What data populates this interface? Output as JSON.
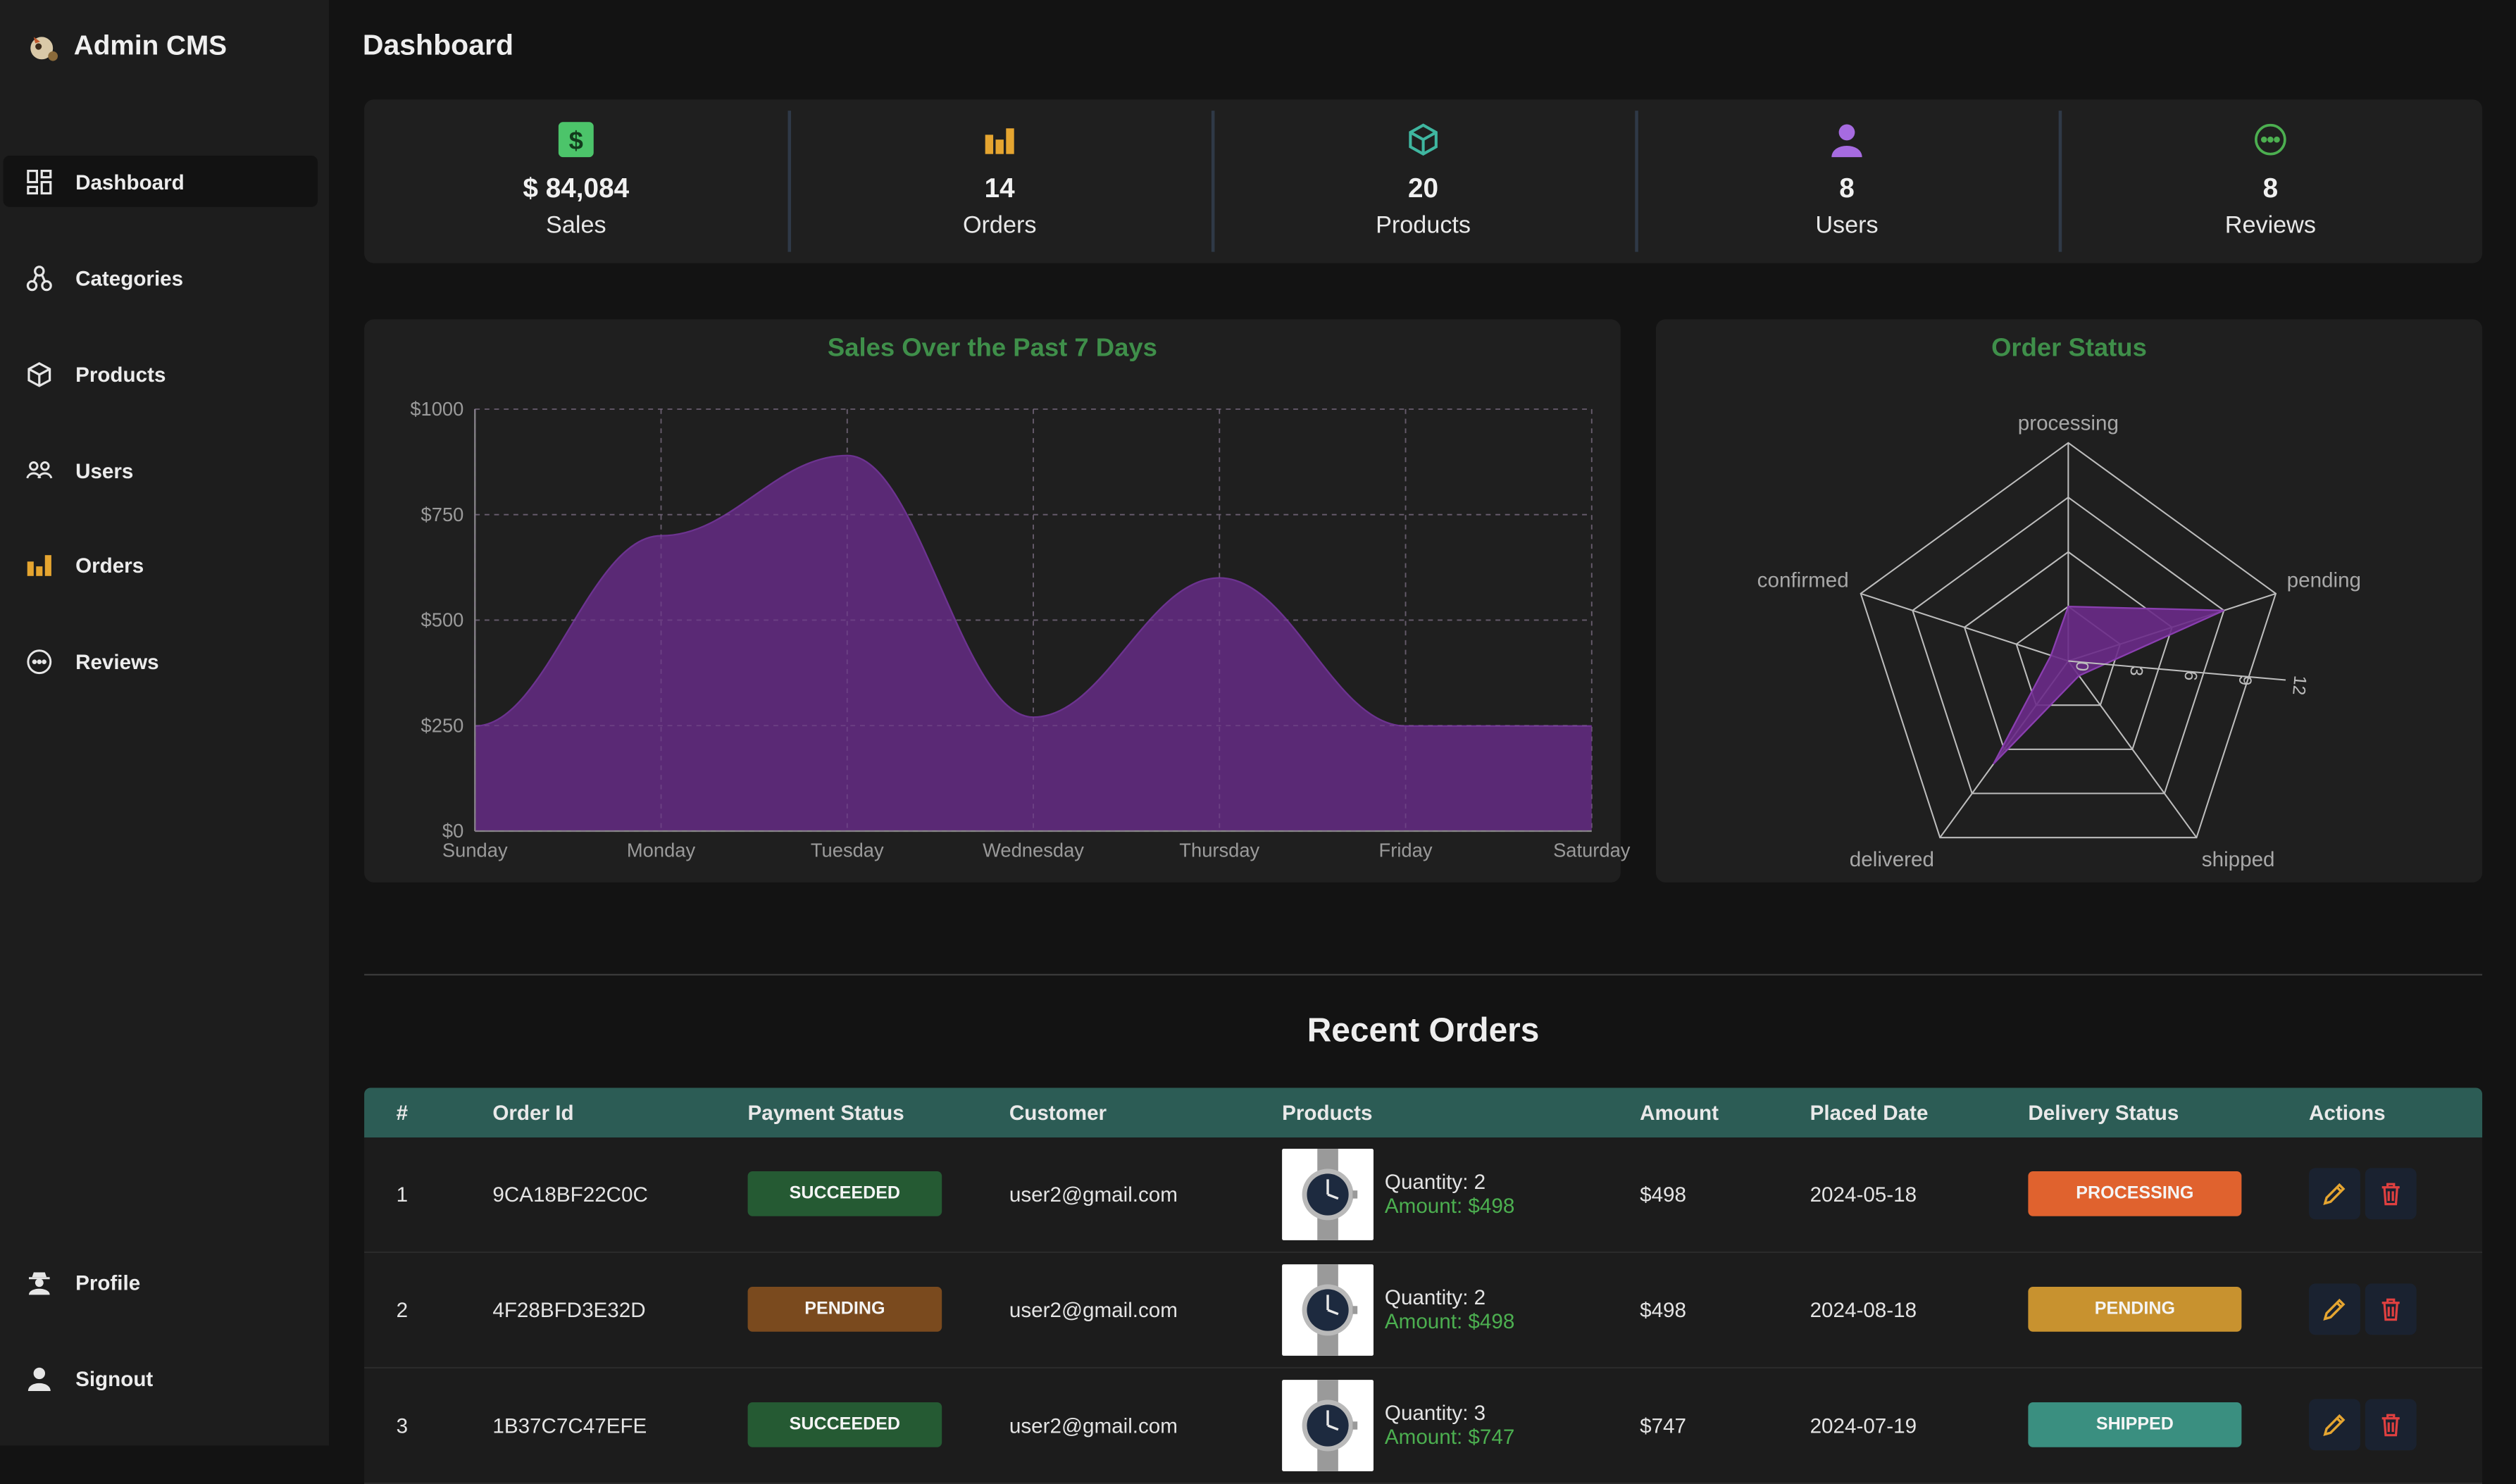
{
  "app": {
    "title": "Admin CMS"
  },
  "sidebar": {
    "items": [
      {
        "label": "Dashboard",
        "icon": "dashboard-icon"
      },
      {
        "label": "Categories",
        "icon": "categories-icon"
      },
      {
        "label": "Products",
        "icon": "cube-icon"
      },
      {
        "label": "Users",
        "icon": "users-icon"
      },
      {
        "label": "Orders",
        "icon": "bar-chart-icon"
      },
      {
        "label": "Reviews",
        "icon": "chat-icon"
      }
    ],
    "bottom": [
      {
        "label": "Profile",
        "icon": "user-secret-icon"
      },
      {
        "label": "Signout",
        "icon": "user-icon"
      }
    ]
  },
  "page": {
    "title": "Dashboard"
  },
  "stats": [
    {
      "value": "$ 84,084",
      "label": "Sales",
      "icon": "dollar-icon",
      "color": "#4cc46a"
    },
    {
      "value": "14",
      "label": "Orders",
      "icon": "bar-chart-icon",
      "color": "#e5a530"
    },
    {
      "value": "20",
      "label": "Products",
      "icon": "cube-icon",
      "color": "#3fb6a0"
    },
    {
      "value": "8",
      "label": "Users",
      "icon": "user-icon",
      "color": "#a66be0"
    },
    {
      "value": "8",
      "label": "Reviews",
      "icon": "chat-icon",
      "color": "#4caf50"
    }
  ],
  "chart_data": [
    {
      "type": "area",
      "title": "Sales Over the Past 7 Days",
      "categories": [
        "Sunday",
        "Monday",
        "Tuesday",
        "Wednesday",
        "Thursday",
        "Friday",
        "Saturday"
      ],
      "values": [
        249,
        700,
        890,
        270,
        600,
        249,
        249
      ],
      "ylim": [
        0,
        1000
      ],
      "yticks": [
        "$0",
        "$250",
        "$500",
        "$750",
        "$1000"
      ],
      "grid": true,
      "color": "#5e2a7a"
    },
    {
      "type": "radar",
      "title": "Order Status",
      "categories": [
        "processing",
        "pending",
        "shipped",
        "delivered",
        "confirmed"
      ],
      "values": [
        3,
        9,
        1,
        7,
        1
      ],
      "rlim": [
        0,
        12
      ],
      "rticks": [
        "0",
        "3",
        "6",
        "9",
        "12"
      ],
      "color": "#6a2a88"
    }
  ],
  "recent_orders": {
    "title": "Recent Orders",
    "columns": [
      "#",
      "Order Id",
      "Payment Status",
      "Customer",
      "Products",
      "Amount",
      "Placed Date",
      "Delivery Status",
      "Actions"
    ],
    "rows": [
      {
        "n": "1",
        "id": "9CA18BF22C0C",
        "payment": "SUCCEEDED",
        "payment_color": "#255a33",
        "customer": "user2@gmail.com",
        "quantity": "Quantity: 2",
        "product_amount": "Amount: $498",
        "amount": "$498",
        "date": "2024-05-18",
        "delivery": "PROCESSING",
        "delivery_color": "#e0622e"
      },
      {
        "n": "2",
        "id": "4F28BFD3E32D",
        "payment": "PENDING",
        "payment_color": "#7a4a1e",
        "customer": "user2@gmail.com",
        "quantity": "Quantity: 2",
        "product_amount": "Amount: $498",
        "amount": "$498",
        "date": "2024-08-18",
        "delivery": "PENDING",
        "delivery_color": "#c8922f"
      },
      {
        "n": "3",
        "id": "1B37C7C47EFE",
        "payment": "SUCCEEDED",
        "payment_color": "#255a33",
        "customer": "user2@gmail.com",
        "quantity": "Quantity: 3",
        "product_amount": "Amount: $747",
        "amount": "$747",
        "date": "2024-07-19",
        "delivery": "SHIPPED",
        "delivery_color": "#3a8f80"
      }
    ]
  }
}
